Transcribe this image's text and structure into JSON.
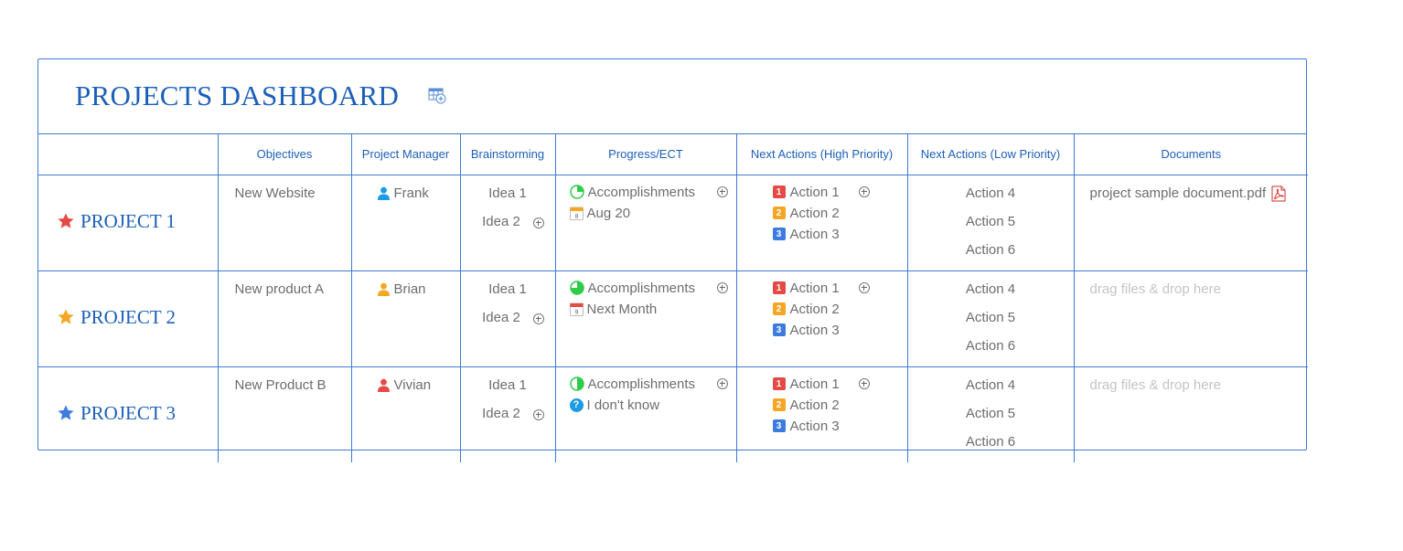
{
  "dashboard": {
    "title": "PROJECTS DASHBOARD",
    "title_icon": "table-add-icon",
    "columns": [
      "",
      "Objectives",
      "Project Manager",
      "Brainstorming",
      "Progress/ECT",
      "Next Actions (High Priority)",
      "Next Actions (Low Priority)",
      "Documents"
    ],
    "rows": [
      {
        "project": "PROJECT 1",
        "star_color": "#e64a45",
        "objective": "New Website",
        "manager": "Frank",
        "manager_color": "#1a9be6",
        "ideas": [
          "Idea 1",
          "Idea 2"
        ],
        "progress": "Accomplishments",
        "progress_fraction": 0.25,
        "progress_color": "#2ecc4a",
        "ect": "Aug 20",
        "ect_icon": "calendar-icon",
        "ect_icon_day": "8",
        "ect_icon_color": "#f5a623",
        "high": [
          "Action 1",
          "Action 2",
          "Action 3"
        ],
        "low": [
          "Action 4",
          "Action 5",
          "Action 6"
        ],
        "document": "project sample document.pdf",
        "document_icon": "pdf-icon"
      },
      {
        "project": "PROJECT 2",
        "star_color": "#f5a623",
        "objective": "New product A",
        "manager": "Brian",
        "manager_color": "#f5a623",
        "ideas": [
          "Idea 1",
          "Idea 2"
        ],
        "progress": "Accomplishments",
        "progress_fraction": 0.75,
        "progress_color": "#2ecc4a",
        "ect": "Next Month",
        "ect_icon": "calendar-icon",
        "ect_icon_day": "9",
        "ect_icon_color": "#e64a45",
        "high": [
          "Action 1",
          "Action 2",
          "Action 3"
        ],
        "low": [
          "Action 4",
          "Action 5",
          "Action 6"
        ],
        "document": "drag files & drop here",
        "document_icon": ""
      },
      {
        "project": "PROJECT 3",
        "star_color": "#3c7be0",
        "objective": "New Product B",
        "manager": "Vivian",
        "manager_color": "#e64a45",
        "ideas": [
          "Idea 1",
          "Idea 2"
        ],
        "progress": "Accomplishments",
        "progress_fraction": 0.5,
        "progress_color": "#2ecc4a",
        "ect": "I don't know",
        "ect_icon": "question-icon",
        "ect_icon_mark": "?",
        "ect_icon_color": "#1a9be6",
        "high": [
          "Action 1",
          "Action 2",
          "Action 3"
        ],
        "low": [
          "Action 4",
          "Action 5",
          "Action 6"
        ],
        "document": "drag files & drop here",
        "document_icon": ""
      }
    ]
  }
}
